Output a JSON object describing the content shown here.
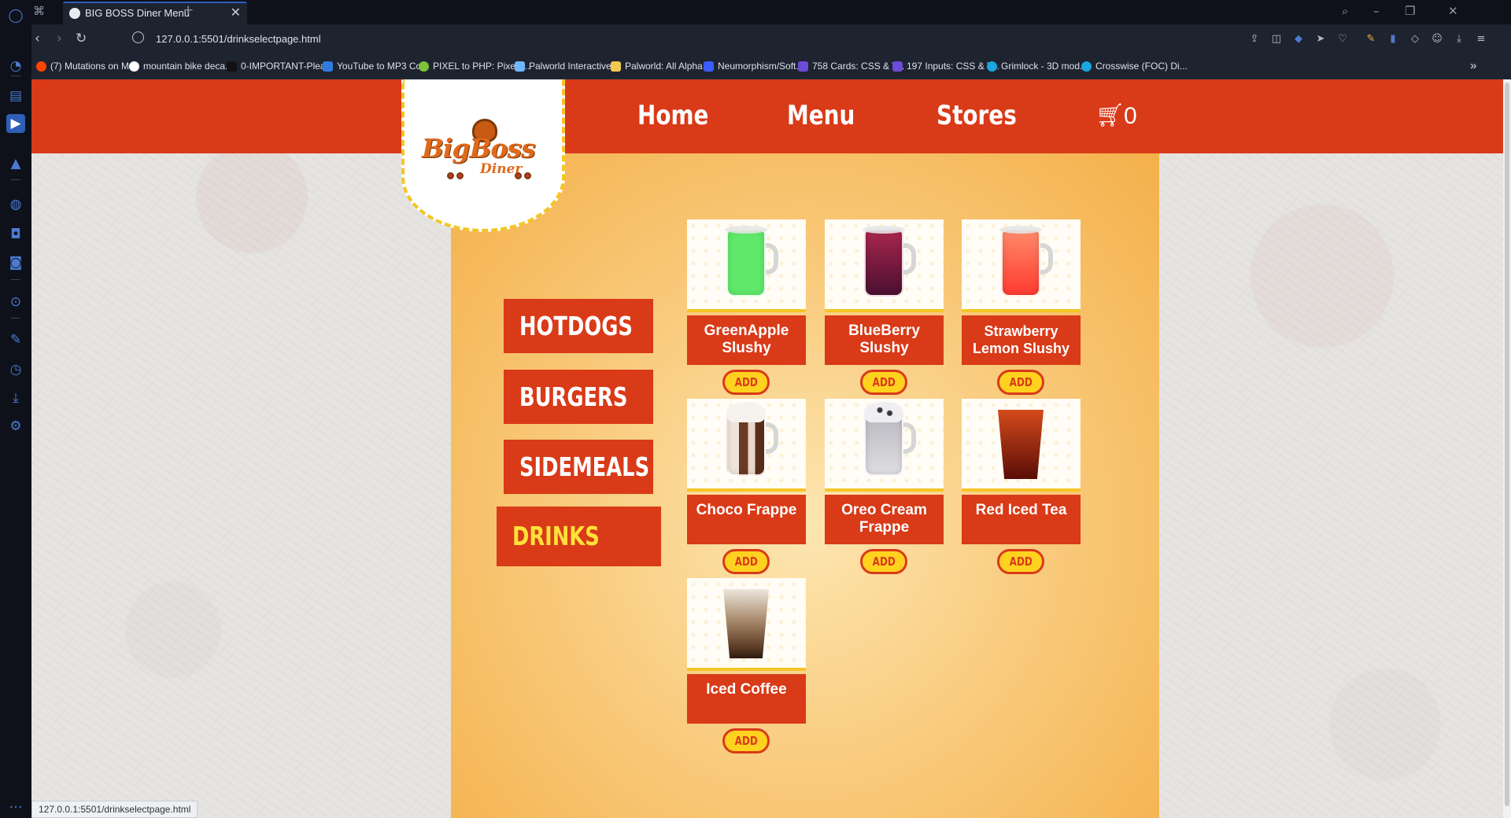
{
  "browser": {
    "tab_title": "BIG BOSS Diner Menu",
    "tab_close": "✕",
    "new_tab": "+",
    "url": "127.0.0.1:5501/drinkselectpage.html",
    "status_url": "127.0.0.1:5501/drinkselectpage.html",
    "bookmarks": [
      {
        "label": "(7) Mutations on M...",
        "color": "#ff4500"
      },
      {
        "label": "mountain bike deca...",
        "color": "#ffffff"
      },
      {
        "label": "0-IMPORTANT-Plea...",
        "color": "#111111"
      },
      {
        "label": "YouTube to MP3 Co...",
        "color": "#2d7be0"
      },
      {
        "label": "PIXEL to PHP: Pixels...",
        "color": "#7ec23a"
      },
      {
        "label": "Palworld Interactive...",
        "color": "#6fb7ff"
      },
      {
        "label": "Palworld: All Alpha...",
        "color": "#f2c94c"
      },
      {
        "label": "Neumorphism/Soft...",
        "color": "#3b5cff"
      },
      {
        "label": "758 Cards: CSS & T...",
        "color": "#6b4bd8"
      },
      {
        "label": "197 Inputs: CSS & T...",
        "color": "#6b4bd8"
      },
      {
        "label": "Grimlock - 3D mod...",
        "color": "#19a7e0"
      },
      {
        "label": "Crosswise (FOC) Di...",
        "color": "#19a7e0"
      }
    ],
    "bookmarks_more": "»"
  },
  "site": {
    "logo_title": "BigBoss",
    "logo_sub": "Diner",
    "nav": {
      "home": "Home",
      "menu": "Menu",
      "stores": "Stores"
    },
    "cart_icon": "cart-icon",
    "cart_count": "0",
    "categories": [
      "HOTDOGS",
      "BURGERS",
      "SIDEMEALS",
      "DRINKS"
    ],
    "active_category": "DRINKS",
    "add_label": "ADD",
    "drinks": [
      {
        "name": "GreenApple Slushy",
        "color": "#5fe86a"
      },
      {
        "name": "BlueBerry Slushy",
        "color": "#7a1a3c"
      },
      {
        "name": "Strawberry Lemon Slushy",
        "color": "#ff5a4a"
      },
      {
        "name": "Choco Frappe",
        "color": "#6b3a22"
      },
      {
        "name": "Oreo Cream Frappe",
        "color": "#c9c7cc"
      },
      {
        "name": "Red Iced Tea",
        "color": "#8a1f0e"
      },
      {
        "name": "Iced Coffee",
        "color": "#8a6a4e"
      }
    ]
  },
  "colors": {
    "header_red": "#d93a18",
    "accent_yellow": "#ffd21f"
  }
}
